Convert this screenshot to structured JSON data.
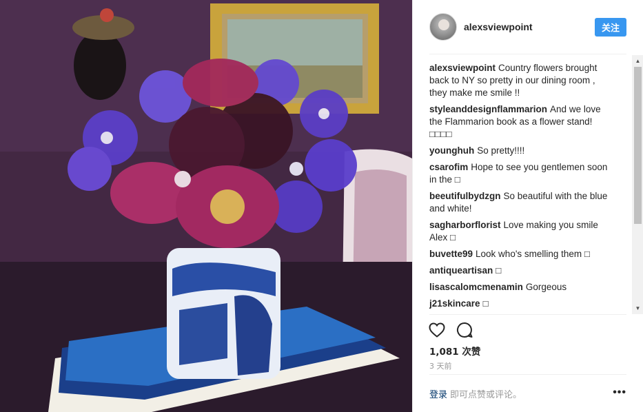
{
  "post": {
    "author": "alexsviewpoint",
    "follow_label": "关注",
    "likes": "1,081 次赞",
    "time": "3 天前"
  },
  "comments": [
    {
      "user": "alexsviewpoint",
      "text": "Country flowers brought back to NY so pretty in our dining room , they make me smile !!"
    },
    {
      "user": "styleanddesignflammarion",
      "text": "And we love the Flammarion book as a flower stand!□□□□"
    },
    {
      "user": "younghuh",
      "text": "So pretty!!!!"
    },
    {
      "user": "csarofim",
      "text": "Hope to see you gentlemen soon in the □"
    },
    {
      "user": "beeutifulbydzgn",
      "text": "So beautiful with the blue and white!"
    },
    {
      "user": "sagharborflorist",
      "text": "Love making you smile Alex □"
    },
    {
      "user": "buvette99",
      "text": "Look who's smelling them □"
    },
    {
      "user": "antiqueartisan",
      "text": "□"
    },
    {
      "user": "lisascalomcmenamin",
      "text": "Gorgeous"
    },
    {
      "user": "j21skincare",
      "text": "□"
    }
  ],
  "footer": {
    "login_label": "登录",
    "prompt": "即可点赞或评论。",
    "more_label": "•••"
  },
  "icons": {
    "like": "heart-icon",
    "comment": "comment-icon",
    "more": "more-options-icon"
  },
  "colors": {
    "follow_button": "#3897f0",
    "login_link": "#003569",
    "muted_text": "#999999"
  }
}
